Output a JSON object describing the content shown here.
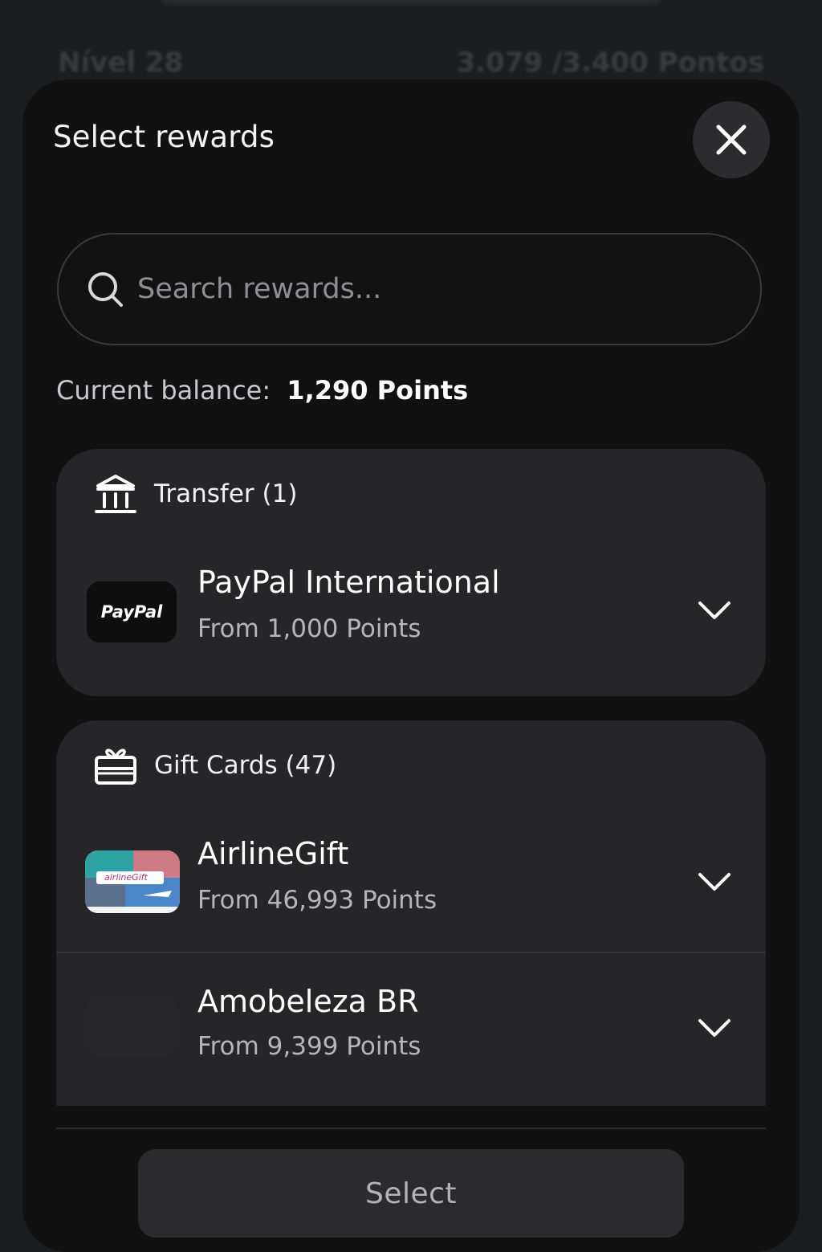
{
  "background": {
    "level_label": "Nível 28",
    "progress_label": "3.079 /3.400 Pontos"
  },
  "sheet": {
    "title": "Select rewards",
    "close_icon": "close-icon",
    "search": {
      "placeholder": "Search rewards...",
      "value": ""
    },
    "balance": {
      "label": "Current balance:",
      "value": "1,290 Points"
    },
    "categories": [
      {
        "icon": "bank-icon",
        "title": "Transfer (1)",
        "items": [
          {
            "logo_text": "PayPal",
            "name": "PayPal International",
            "price": "From 1,000 Points"
          }
        ]
      },
      {
        "icon": "gift-card-icon",
        "title": "Gift Cards (47)",
        "items": [
          {
            "logo_text": "airlineGift",
            "name": "AirlineGift",
            "price": "From 46,993 Points"
          },
          {
            "logo_text": "",
            "name": "Amobeleza BR",
            "price": "From 9,399 Points"
          }
        ]
      }
    ],
    "select_button": "Select"
  },
  "colors": {
    "sheet_bg": "#111111",
    "card_bg": "#262628",
    "muted_text": "#b6b6ba",
    "button_bg": "#2b2b2d"
  }
}
